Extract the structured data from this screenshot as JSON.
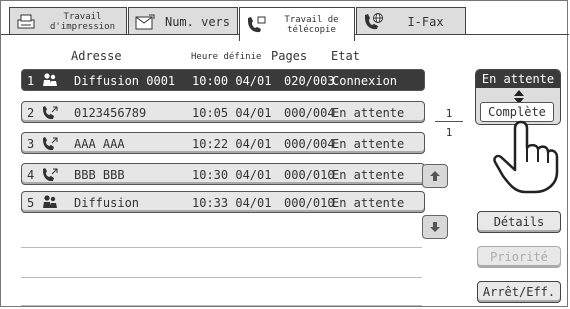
{
  "tabs": [
    {
      "label_line1": "Travail",
      "label_line2": "d'impression",
      "icon": "printer-icon"
    },
    {
      "label": "Num. vers",
      "icon": "scan-send-icon"
    },
    {
      "label_line1": "Travail de",
      "label_line2": "télécopie",
      "icon": "fax-phone-icon"
    },
    {
      "label": "I-Fax",
      "icon": "internet-fax-icon"
    }
  ],
  "columns": {
    "address": "Adresse",
    "time": "Heure définie",
    "pages": "Pages",
    "state": "Etat"
  },
  "jobs": [
    {
      "num": "1",
      "icon": "group-broadcast-icon",
      "address": "Diffusion 0001",
      "time": "10:00 04/01",
      "pages": "020/003",
      "state": "Connexion"
    },
    {
      "num": "2",
      "icon": "fax-phone-icon",
      "address": "0123456789",
      "time": "10:05 04/01",
      "pages": "000/004",
      "state": "En attente"
    },
    {
      "num": "3",
      "icon": "fax-phone-icon",
      "address": "AAA AAA",
      "time": "10:22 04/01",
      "pages": "000/004",
      "state": "En attente"
    },
    {
      "num": "4",
      "icon": "fax-phone-icon",
      "address": "BBB BBB",
      "time": "10:30 04/01",
      "pages": "000/010",
      "state": "En attente"
    },
    {
      "num": "5",
      "icon": "group-broadcast-icon",
      "address": "Diffusion",
      "time": "10:33 04/01",
      "pages": "000/010",
      "state": "En attente"
    }
  ],
  "pager": {
    "current": "1",
    "total": "1"
  },
  "toggle": {
    "selected": "En attente",
    "other": "Complète"
  },
  "buttons": {
    "details": "Détails",
    "priority": "Priorité",
    "stop_delete": "Arrêt/Eff."
  }
}
